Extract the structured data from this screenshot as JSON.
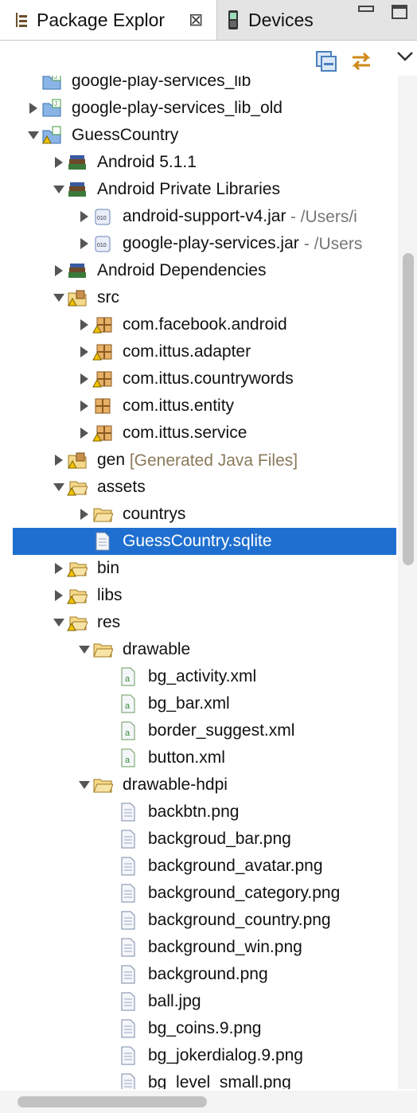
{
  "tabs": {
    "active_label": "Package Explor",
    "inactive_label": "Devices",
    "close_glyph": "⊠"
  },
  "toolbar": {
    "collapse_icon": "collapse-all-icon",
    "link_icon": "link-with-editor-icon",
    "menu_icon": "view-menu-icon"
  },
  "tree": [
    {
      "label": "google-play-services_lib",
      "decoration": "",
      "indent": 0,
      "twisty": "none",
      "icon": "project",
      "cut": true
    },
    {
      "label": "google-play-services_lib_old",
      "decoration": "",
      "indent": 0,
      "twisty": "collapsed",
      "icon": "project"
    },
    {
      "label": "GuessCountry",
      "decoration": "",
      "indent": 0,
      "twisty": "expanded",
      "icon": "project-warn"
    },
    {
      "label": "Android 5.1.1",
      "decoration": "",
      "indent": 1,
      "twisty": "collapsed",
      "icon": "library"
    },
    {
      "label": "Android Private Libraries",
      "decoration": "",
      "indent": 1,
      "twisty": "expanded",
      "icon": "library"
    },
    {
      "label": "android-support-v4.jar",
      "decoration": " - /Users/i",
      "indent": 2,
      "twisty": "collapsed",
      "icon": "jar"
    },
    {
      "label": "google-play-services.jar",
      "decoration": " - /Users",
      "indent": 2,
      "twisty": "collapsed",
      "icon": "jar"
    },
    {
      "label": "Android Dependencies",
      "decoration": "",
      "indent": 1,
      "twisty": "collapsed",
      "icon": "library"
    },
    {
      "label": "src",
      "decoration": "",
      "indent": 1,
      "twisty": "expanded",
      "icon": "srcfolder-warn"
    },
    {
      "label": "com.facebook.android",
      "decoration": "",
      "indent": 2,
      "twisty": "collapsed",
      "icon": "package-warn"
    },
    {
      "label": "com.ittus.adapter",
      "decoration": "",
      "indent": 2,
      "twisty": "collapsed",
      "icon": "package-warn"
    },
    {
      "label": "com.ittus.countrywords",
      "decoration": "",
      "indent": 2,
      "twisty": "collapsed",
      "icon": "package-warn"
    },
    {
      "label": "com.ittus.entity",
      "decoration": "",
      "indent": 2,
      "twisty": "collapsed",
      "icon": "package"
    },
    {
      "label": "com.ittus.service",
      "decoration": "",
      "indent": 2,
      "twisty": "collapsed",
      "icon": "package-warn"
    },
    {
      "label": "gen",
      "decoration": " [Generated Java Files]",
      "indent": 1,
      "twisty": "collapsed",
      "icon": "srcfolder-warn"
    },
    {
      "label": "assets",
      "decoration": "",
      "indent": 1,
      "twisty": "expanded",
      "icon": "folder-warn"
    },
    {
      "label": "countrys",
      "decoration": "",
      "indent": 2,
      "twisty": "collapsed",
      "icon": "folder"
    },
    {
      "label": "GuessCountry.sqlite",
      "decoration": "",
      "indent": 2,
      "twisty": "none",
      "icon": "file",
      "selected": true
    },
    {
      "label": "bin",
      "decoration": "",
      "indent": 1,
      "twisty": "collapsed",
      "icon": "folder-warn"
    },
    {
      "label": "libs",
      "decoration": "",
      "indent": 1,
      "twisty": "collapsed",
      "icon": "folder-warn"
    },
    {
      "label": "res",
      "decoration": "",
      "indent": 1,
      "twisty": "expanded",
      "icon": "folder-warn"
    },
    {
      "label": "drawable",
      "decoration": "",
      "indent": 2,
      "twisty": "expanded",
      "icon": "folder"
    },
    {
      "label": "bg_activity.xml",
      "decoration": "",
      "indent": 3,
      "twisty": "none",
      "icon": "xml"
    },
    {
      "label": "bg_bar.xml",
      "decoration": "",
      "indent": 3,
      "twisty": "none",
      "icon": "xml"
    },
    {
      "label": "border_suggest.xml",
      "decoration": "",
      "indent": 3,
      "twisty": "none",
      "icon": "xml"
    },
    {
      "label": "button.xml",
      "decoration": "",
      "indent": 3,
      "twisty": "none",
      "icon": "xml"
    },
    {
      "label": "drawable-hdpi",
      "decoration": "",
      "indent": 2,
      "twisty": "expanded",
      "icon": "folder"
    },
    {
      "label": "backbtn.png",
      "decoration": "",
      "indent": 3,
      "twisty": "none",
      "icon": "file"
    },
    {
      "label": "backgroud_bar.png",
      "decoration": "",
      "indent": 3,
      "twisty": "none",
      "icon": "file"
    },
    {
      "label": "background_avatar.png",
      "decoration": "",
      "indent": 3,
      "twisty": "none",
      "icon": "file"
    },
    {
      "label": "background_category.png",
      "decoration": "",
      "indent": 3,
      "twisty": "none",
      "icon": "file"
    },
    {
      "label": "background_country.png",
      "decoration": "",
      "indent": 3,
      "twisty": "none",
      "icon": "file"
    },
    {
      "label": "background_win.png",
      "decoration": "",
      "indent": 3,
      "twisty": "none",
      "icon": "file"
    },
    {
      "label": "background.png",
      "decoration": "",
      "indent": 3,
      "twisty": "none",
      "icon": "file"
    },
    {
      "label": "ball.jpg",
      "decoration": "",
      "indent": 3,
      "twisty": "none",
      "icon": "file"
    },
    {
      "label": "bg_coins.9.png",
      "decoration": "",
      "indent": 3,
      "twisty": "none",
      "icon": "file"
    },
    {
      "label": "bg_jokerdialog.9.png",
      "decoration": "",
      "indent": 3,
      "twisty": "none",
      "icon": "file"
    },
    {
      "label": "bg_level_small.png",
      "decoration": "",
      "indent": 3,
      "twisty": "none",
      "icon": "file"
    }
  ]
}
